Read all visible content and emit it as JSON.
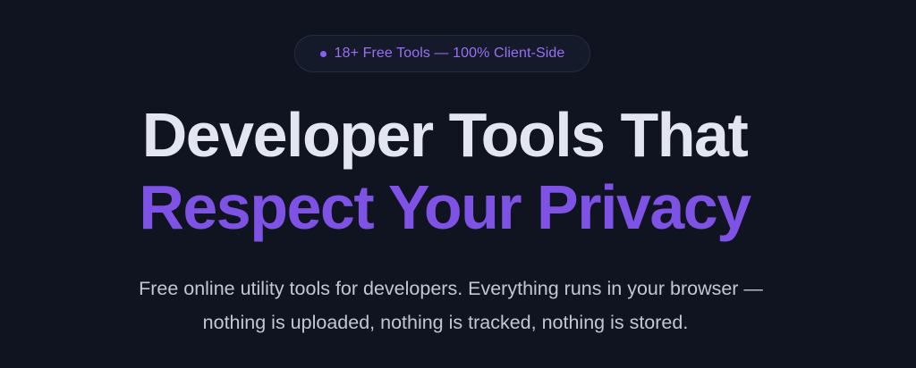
{
  "hero": {
    "badge": {
      "text": "18+ Free Tools — 100% Client-Side",
      "dot_icon": "dot-icon",
      "color": "#8b5cf6"
    },
    "headline": {
      "line1": "Developer Tools That",
      "line2": "Respect Your Privacy",
      "line1_color": "#e3e6f1",
      "line2_color": "#7e52e4"
    },
    "subtitle": {
      "line1": "Free online utility tools for developers. Everything runs in your browser —",
      "line2": "nothing is uploaded, nothing is tracked, nothing is stored."
    },
    "background_color": "#0f1420"
  }
}
